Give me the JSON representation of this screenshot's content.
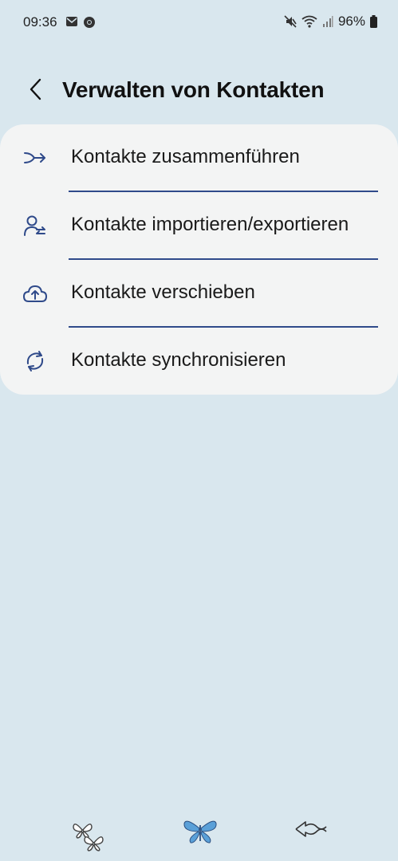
{
  "status_bar": {
    "time": "09:36",
    "battery": "96%",
    "icons": [
      "email-icon",
      "chrome-icon",
      "mute-icon",
      "wifi-icon",
      "signal-icon",
      "battery-icon"
    ]
  },
  "header": {
    "title": "Verwalten von Kontakten"
  },
  "menu": {
    "items": [
      {
        "label": "Kontakte zusammenführen",
        "icon": "merge-icon"
      },
      {
        "label": "Kontakte importieren/exportieren",
        "icon": "import-export-icon"
      },
      {
        "label": "Kontakte verschieben",
        "icon": "cloud-upload-icon"
      },
      {
        "label": "Kontakte synchronisieren",
        "icon": "sync-icon"
      }
    ]
  },
  "nav_bar": {
    "buttons": [
      "recent-apps",
      "home",
      "back"
    ]
  },
  "colors": {
    "background": "#d9e7ee",
    "card": "#f3f4f4",
    "accent": "#2f4a8a"
  }
}
